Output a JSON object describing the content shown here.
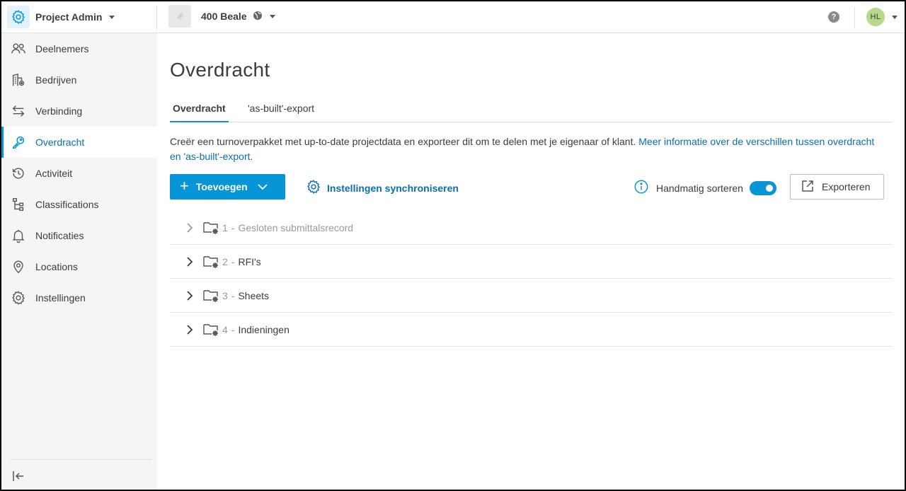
{
  "topbar": {
    "app_name": "Project Admin",
    "project_name": "400 Beale",
    "help_symbol": "?",
    "user_initials": "HL"
  },
  "sidebar": {
    "items": [
      {
        "label": "Deelnemers",
        "icon": "people-icon"
      },
      {
        "label": "Bedrijven",
        "icon": "building-icon"
      },
      {
        "label": "Verbinding",
        "icon": "arrows-swap-icon"
      },
      {
        "label": "Overdracht",
        "icon": "key-icon",
        "active": true
      },
      {
        "label": "Activiteit",
        "icon": "history-icon"
      },
      {
        "label": "Classifications",
        "icon": "tree-icon"
      },
      {
        "label": "Notificaties",
        "icon": "bell-icon"
      },
      {
        "label": "Locations",
        "icon": "map-pin-icon"
      },
      {
        "label": "Instellingen",
        "icon": "gear-icon"
      }
    ]
  },
  "main": {
    "title": "Overdracht",
    "tabs": [
      {
        "label": "Overdracht",
        "active": true
      },
      {
        "label": "'as-built'-export",
        "active": false
      }
    ],
    "description": "Creër een turnoverpakket met up-to-date projectdata en exporteer dit om te delen met je eigenaar of klant. ",
    "description_link": "Meer informatie over de verschillen tussen overdracht en 'as-built'-export.",
    "toolbar": {
      "add_label": "Toevoegen",
      "sync_label": "Instellingen synchroniseren",
      "sort_label": "Handmatig sorteren",
      "sort_enabled": true,
      "export_label": "Exporteren"
    },
    "rows": [
      {
        "num": "1",
        "name": "Gesloten submittalsrecord",
        "disabled": true
      },
      {
        "num": "2",
        "name": "RFI's",
        "disabled": false
      },
      {
        "num": "3",
        "name": "Sheets",
        "disabled": false
      },
      {
        "num": "4",
        "name": "Indieningen",
        "disabled": false
      }
    ]
  },
  "colors": {
    "accent": "#0696d7",
    "link": "#0b6fb0",
    "sidebar_bg": "#f5f5f5"
  }
}
